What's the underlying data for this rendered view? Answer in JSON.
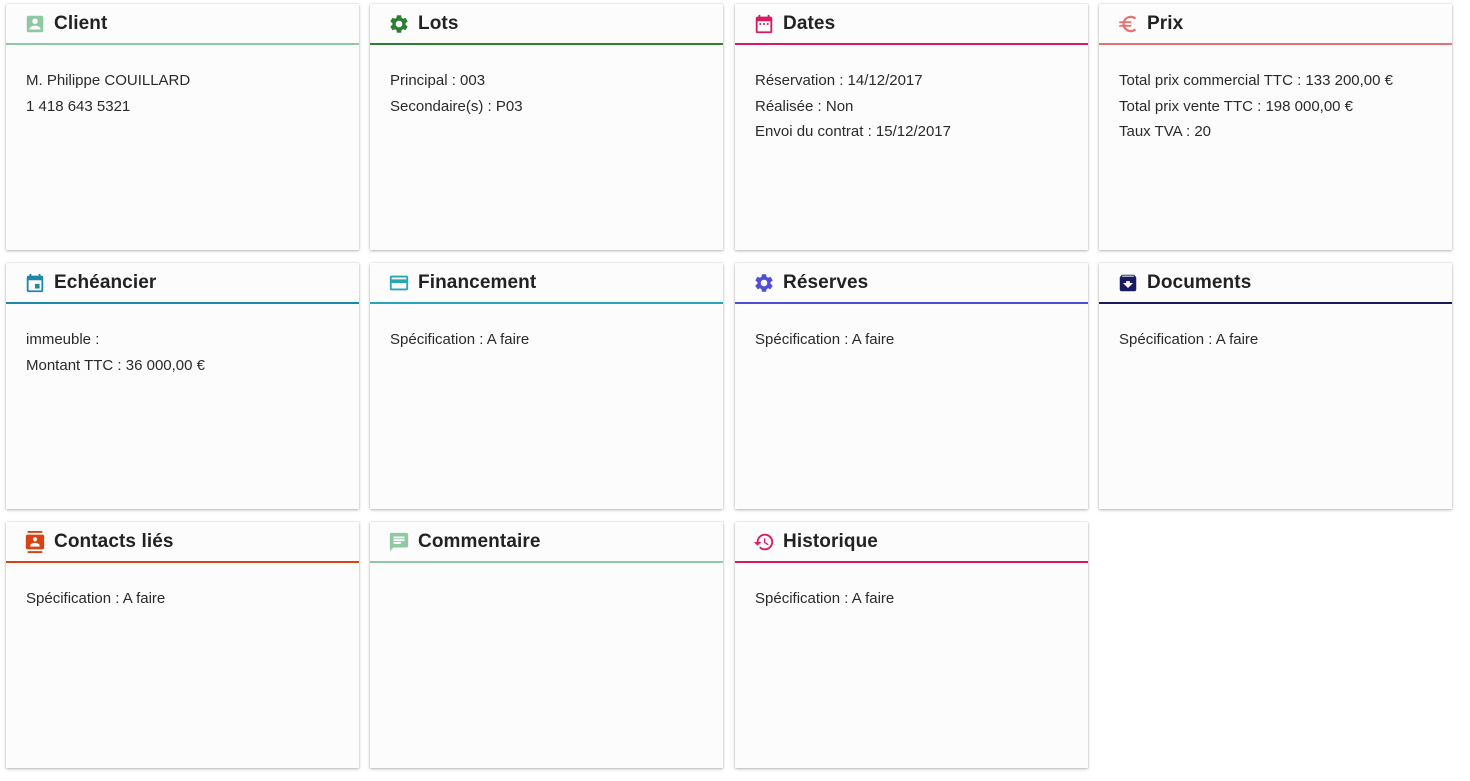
{
  "cards": [
    {
      "title": "Client",
      "icon": "account-box-icon",
      "color": "#8fc9a3",
      "lines": [
        "M. Philippe COUILLARD",
        "1 418 643 5321"
      ]
    },
    {
      "title": "Lots",
      "icon": "gear-icon",
      "color": "#2e7d32",
      "lines": [
        "Principal : 003",
        "Secondaire(s) : P03"
      ]
    },
    {
      "title": "Dates",
      "icon": "calendar-dots-icon",
      "color": "#d81b60",
      "lines": [
        "Réservation : 14/12/2017",
        "Réalisée : Non",
        "Envoi du contrat : 15/12/2017"
      ]
    },
    {
      "title": "Prix",
      "icon": "euro-icon",
      "color": "#e57373",
      "lines": [
        "Total prix commercial TTC : 133 200,00 €",
        "Total prix vente TTC : 198 000,00 €",
        "Taux TVA : 20"
      ]
    },
    {
      "title": "Echéancier",
      "icon": "calendar-icon",
      "color": "#1e88a8",
      "lines": [
        "immeuble :",
        "Montant TTC : 36 000,00 €"
      ]
    },
    {
      "title": "Financement",
      "icon": "credit-card-icon",
      "color": "#26a6b8",
      "lines": [
        "Spécification : A faire"
      ]
    },
    {
      "title": "Réserves",
      "icon": "gear-icon",
      "color": "#4f4fd6",
      "lines": [
        "Spécification : A faire"
      ]
    },
    {
      "title": "Documents",
      "icon": "archive-icon",
      "color": "#1a1a5e",
      "lines": [
        "Spécification : A faire"
      ]
    },
    {
      "title": "Contacts liés",
      "icon": "contacts-icon",
      "color": "#d84315",
      "lines": [
        "Spécification : A faire"
      ]
    },
    {
      "title": "Commentaire",
      "icon": "comment-icon",
      "color": "#8fc9a3",
      "lines": []
    },
    {
      "title": "Historique",
      "icon": "history-icon",
      "color": "#d81b60",
      "lines": [
        "Spécification : A faire"
      ]
    }
  ]
}
